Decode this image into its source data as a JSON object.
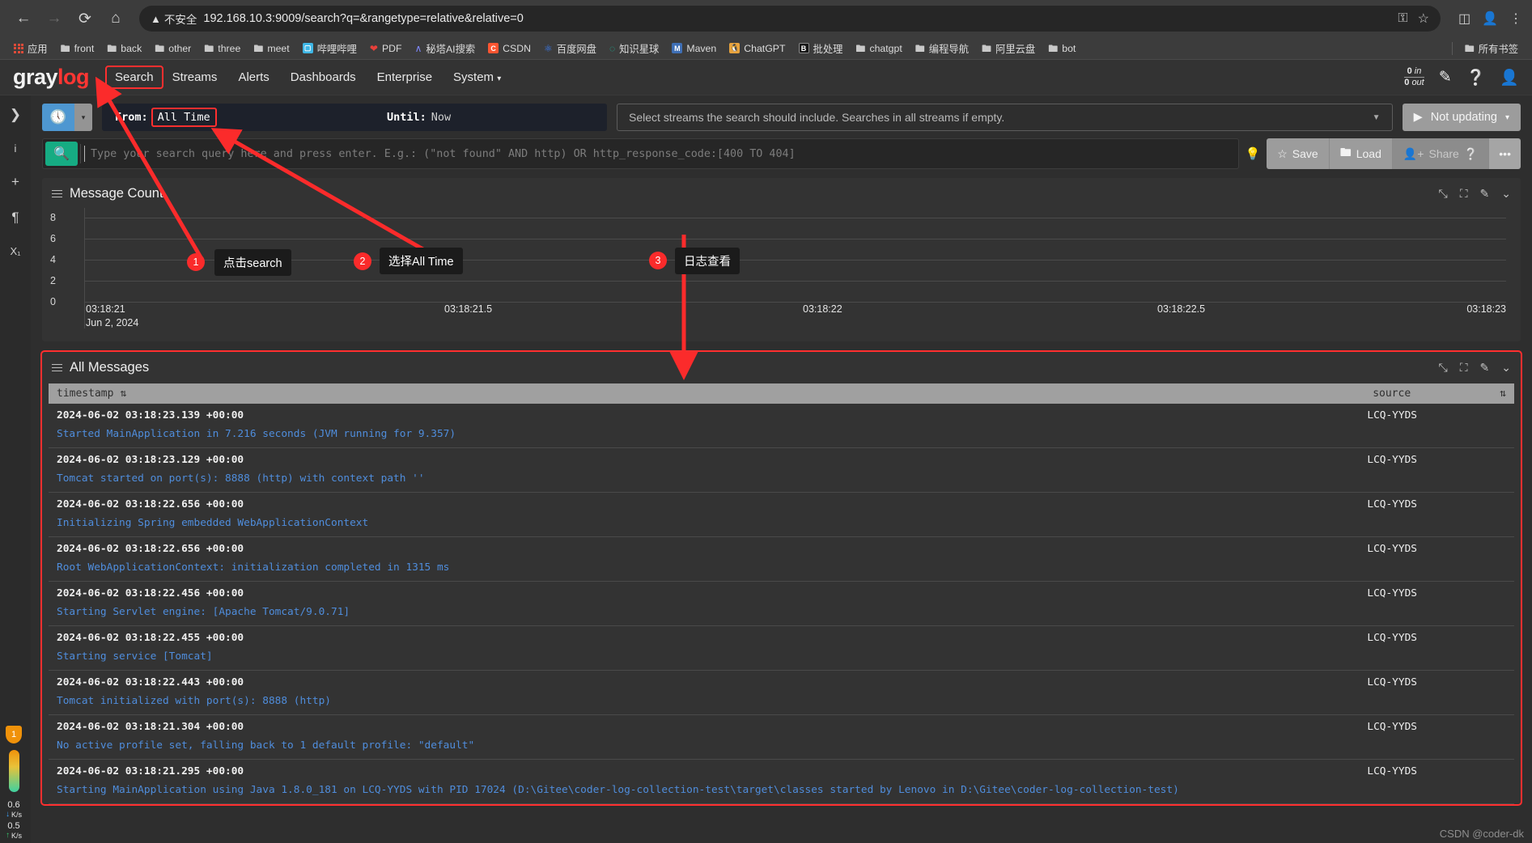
{
  "browser": {
    "back_icon": "back-arrow-icon",
    "forward_icon": "forward-arrow-icon",
    "reload_icon": "reload-icon",
    "home_icon": "home-icon",
    "security_label": "不安全",
    "url": "192.168.10.3:9009/search?q=&rangetype=relative&relative=0",
    "bookmarks": [
      {
        "label": "应用",
        "icon": "apps-grid-icon"
      },
      {
        "label": "front",
        "icon": "folder-icon"
      },
      {
        "label": "back",
        "icon": "folder-icon"
      },
      {
        "label": "other",
        "icon": "folder-icon"
      },
      {
        "label": "three",
        "icon": "folder-icon"
      },
      {
        "label": "meet",
        "icon": "folder-icon"
      },
      {
        "label": "哔哩哔哩",
        "icon": "bilibili-icon"
      },
      {
        "label": "PDF",
        "icon": "pdf-heart-icon"
      },
      {
        "label": "秘塔AI搜索",
        "icon": "metaso-icon"
      },
      {
        "label": "CSDN",
        "icon": "csdn-icon"
      },
      {
        "label": "百度网盘",
        "icon": "baidu-pan-icon"
      },
      {
        "label": "知识星球",
        "icon": "zsxq-icon"
      },
      {
        "label": "Maven",
        "icon": "maven-icon"
      },
      {
        "label": "ChatGPT",
        "icon": "chatgpt-icon"
      },
      {
        "label": "批处理",
        "icon": "batch-icon"
      },
      {
        "label": "chatgpt",
        "icon": "folder-icon"
      },
      {
        "label": "编程导航",
        "icon": "folder-icon"
      },
      {
        "label": "阿里云盘",
        "icon": "folder-icon"
      },
      {
        "label": "bot",
        "icon": "folder-icon"
      }
    ],
    "all_bookmarks_label": "所有书签"
  },
  "graylog": {
    "logo_gray": "gray",
    "logo_log": "log",
    "nav": [
      {
        "label": "Search",
        "highlighted": true
      },
      {
        "label": "Streams",
        "highlighted": false
      },
      {
        "label": "Alerts",
        "highlighted": false
      },
      {
        "label": "Dashboards",
        "highlighted": false
      },
      {
        "label": "Enterprise",
        "highlighted": false
      },
      {
        "label": "System",
        "highlighted": false
      }
    ],
    "system_caret": "▾",
    "throughput": {
      "in": "0 in",
      "out": "0 out",
      "in_num": "0",
      "in_unit": "in",
      "out_num": "0",
      "out_unit": "out"
    },
    "icons": {
      "edit": "pencil-square-icon",
      "help": "help-circle-icon",
      "user": "user-avatar-icon"
    }
  },
  "rail": {
    "items": [
      {
        "icon": "chevron-right-icon",
        "glyph": "❯"
      },
      {
        "icon": "info-icon",
        "glyph": "i"
      },
      {
        "icon": "plus-icon",
        "glyph": "+"
      },
      {
        "icon": "paragraph-icon",
        "glyph": "¶"
      },
      {
        "icon": "subscript-icon",
        "glyph": "X₁"
      }
    ]
  },
  "timerange": {
    "clock_icon": "clock-icon",
    "caret": "▾",
    "from_label": "From:",
    "from_value": "All Time",
    "until_label": "Until:",
    "until_value": "Now"
  },
  "streams": {
    "placeholder": "Select streams the search should include. Searches in all streams if empty.",
    "caret": "▼"
  },
  "refresh": {
    "play_icon": "play-icon",
    "label": "Not updating",
    "caret": "▾"
  },
  "query": {
    "search_icon": "search-magnifier-icon",
    "placeholder": "Type your search query here and press enter. E.g.: (\"not found\" AND http) OR http_response_code:[400 TO 404]",
    "value": "",
    "bulb_icon": "lightbulb-icon"
  },
  "actions": {
    "save": "Save",
    "load": "Load",
    "share": "Share",
    "more": "•••",
    "save_icon": "star-icon",
    "load_icon": "folder-icon",
    "share_icon": "person-add-icon",
    "share_help_icon": "help-circle-icon"
  },
  "message_count_panel": {
    "title": "Message Count",
    "menu_icon": "hamburger-icon",
    "tools": [
      {
        "icon": "move-resize-icon",
        "glyph": "⤡"
      },
      {
        "icon": "fullscreen-icon",
        "glyph": "⛶"
      },
      {
        "icon": "edit-icon",
        "glyph": "✎"
      },
      {
        "icon": "chevron-down-icon",
        "glyph": "⌄"
      }
    ]
  },
  "chart_data": {
    "type": "bar",
    "title": "Message Count",
    "xlabel": "",
    "ylabel": "",
    "x_ticks": [
      "03:18:21",
      "03:18:21.5",
      "03:18:22",
      "03:18:22.5",
      "03:18:23"
    ],
    "x_date": "Jun 2, 2024",
    "y_ticks": [
      8,
      6,
      4,
      2,
      0
    ],
    "ylim": [
      0,
      9
    ],
    "categories": [
      "03:18:21",
      "03:18:21.5",
      "03:18:22",
      "03:18:22.5",
      "03:18:23"
    ],
    "values": [
      0,
      0,
      0,
      0,
      0
    ],
    "grid": true,
    "legend": "none"
  },
  "messages_panel": {
    "title": "All Messages",
    "menu_icon": "hamburger-icon",
    "tools": [
      {
        "icon": "move-resize-icon",
        "glyph": "⤡"
      },
      {
        "icon": "fullscreen-icon",
        "glyph": "⛶"
      },
      {
        "icon": "edit-icon",
        "glyph": "✎"
      },
      {
        "icon": "chevron-down-icon",
        "glyph": "⌄"
      }
    ],
    "columns": [
      {
        "label": "timestamp",
        "sort_icon": "sort-icon"
      },
      {
        "label": "source",
        "sort_icon": "sort-icon"
      }
    ],
    "rows": [
      {
        "timestamp": "2024-06-02 03:18:23.139 +00:00",
        "source": "LCQ-YYDS",
        "message": "Started MainApplication in 7.216 seconds (JVM running for 9.357)"
      },
      {
        "timestamp": "2024-06-02 03:18:23.129 +00:00",
        "source": "LCQ-YYDS",
        "message": "Tomcat started on port(s): 8888 (http) with context path ''"
      },
      {
        "timestamp": "2024-06-02 03:18:22.656 +00:00",
        "source": "LCQ-YYDS",
        "message": "Initializing Spring embedded WebApplicationContext"
      },
      {
        "timestamp": "2024-06-02 03:18:22.656 +00:00",
        "source": "LCQ-YYDS",
        "message": "Root WebApplicationContext: initialization completed in 1315 ms"
      },
      {
        "timestamp": "2024-06-02 03:18:22.456 +00:00",
        "source": "LCQ-YYDS",
        "message": "Starting Servlet engine: [Apache Tomcat/9.0.71]"
      },
      {
        "timestamp": "2024-06-02 03:18:22.455 +00:00",
        "source": "LCQ-YYDS",
        "message": "Starting service [Tomcat]"
      },
      {
        "timestamp": "2024-06-02 03:18:22.443 +00:00",
        "source": "LCQ-YYDS",
        "message": "Tomcat initialized with port(s): 8888 (http)"
      },
      {
        "timestamp": "2024-06-02 03:18:21.304 +00:00",
        "source": "LCQ-YYDS",
        "message": "No active profile set, falling back to 1 default profile: \"default\""
      },
      {
        "timestamp": "2024-06-02 03:18:21.295 +00:00",
        "source": "LCQ-YYDS",
        "message": "Starting MainApplication using Java 1.8.0_181 on LCQ-YYDS with PID 17024 (D:\\Gitee\\coder-log-collection-test\\target\\classes started by Lenovo in D:\\Gitee\\coder-log-collection-test)"
      }
    ]
  },
  "annotations": {
    "accent_color": "#ff2f2f",
    "items": [
      {
        "number": "1",
        "label": "点击search"
      },
      {
        "number": "2",
        "label": "选择All Time"
      },
      {
        "number": "3",
        "label": "日志查看"
      }
    ]
  },
  "floating": {
    "shield_badge": "1",
    "download_speed": {
      "value": "0.6",
      "unit": "K/s",
      "arrow": "↓"
    },
    "upload_speed": {
      "value": "0.5",
      "unit": "K/s",
      "arrow": "↑"
    }
  },
  "watermark": "CSDN @coder-dk"
}
